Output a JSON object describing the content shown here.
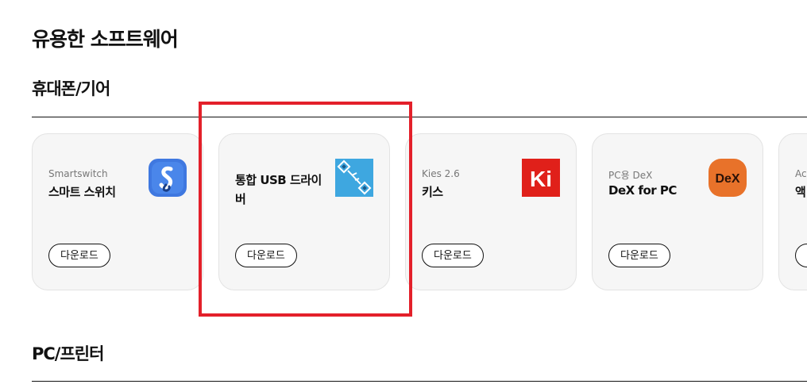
{
  "page": {
    "title": "유용한 소프트웨어"
  },
  "sections": [
    {
      "title": "휴대폰/기어"
    },
    {
      "title": "PC/프린터"
    }
  ],
  "cards": [
    {
      "subtitle": "Smartswitch",
      "name": "스마트 스위치",
      "button": "다운로드",
      "icon": "smart-switch-icon",
      "color": "#3f78e0"
    },
    {
      "subtitle": "",
      "name": "통합 USB 드라이버",
      "button": "다운로드",
      "icon": "usb-driver-icon",
      "color": "#3ea7e0"
    },
    {
      "subtitle": "Kies 2.6",
      "name": "키스",
      "button": "다운로드",
      "icon": "kies-icon",
      "color": "#e0201a"
    },
    {
      "subtitle": "PC용 DeX",
      "name": "DeX for PC",
      "button": "다운로드",
      "icon": "dex-icon",
      "color": "#e8722a"
    },
    {
      "subtitle": "Ac",
      "name": "액",
      "button": "",
      "icon": "",
      "color": ""
    }
  ],
  "icon_text": {
    "kies": "Ki",
    "dex": "DeX"
  },
  "highlight_color": "#e3202a"
}
